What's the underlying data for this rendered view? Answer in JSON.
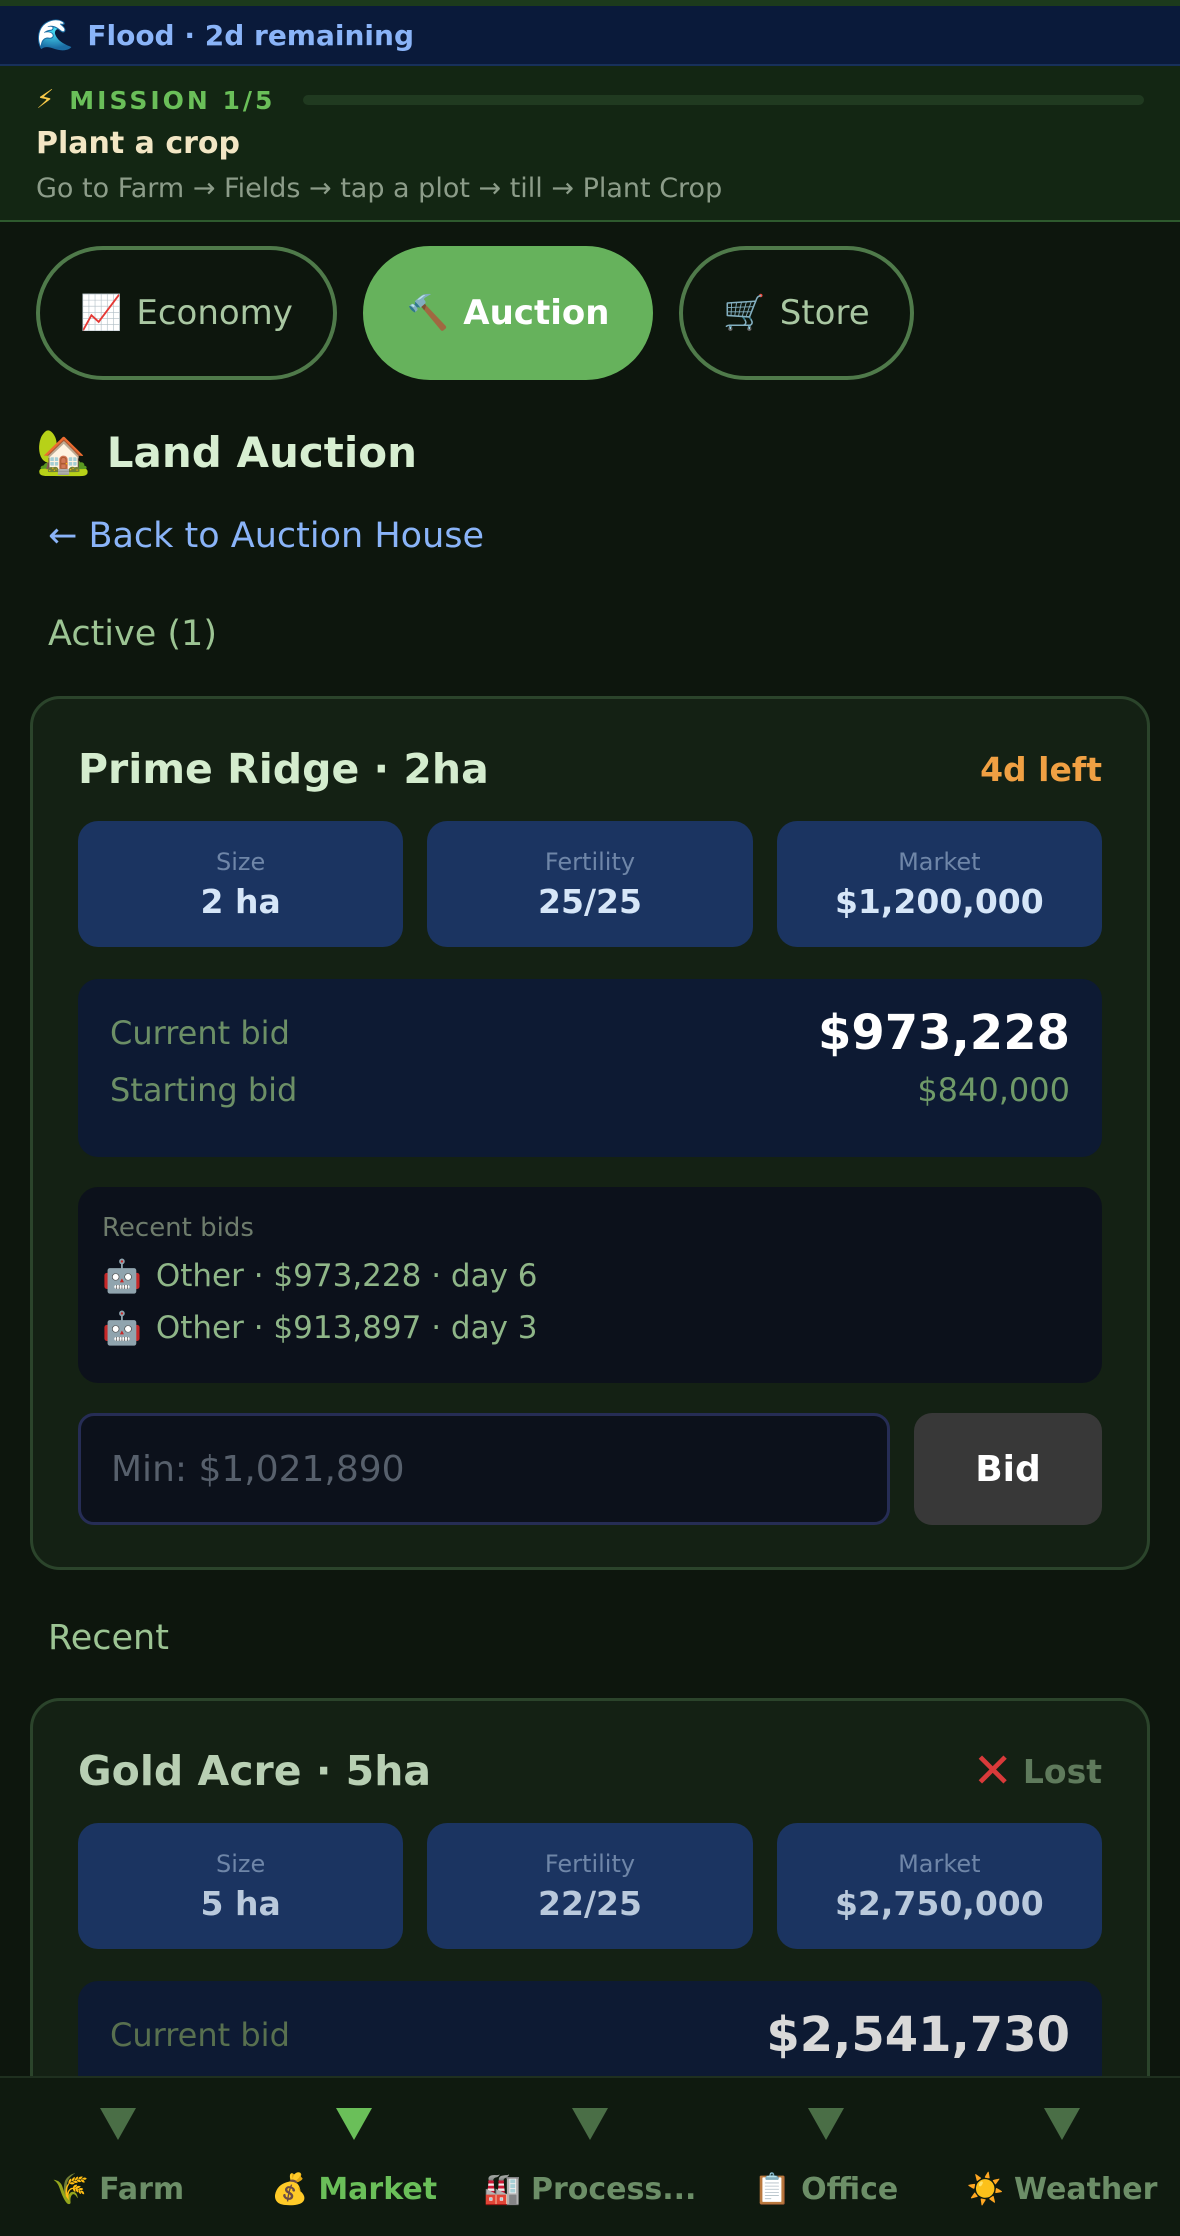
{
  "alert": {
    "icon": "🌊",
    "text": "Flood · 2d remaining"
  },
  "mission": {
    "icon": "⚡",
    "tag": "MISSION 1/5",
    "progress": 0.0,
    "title": "Plant a crop",
    "description": "Go to Farm → Fields → tap a plot → till → Plant Crop"
  },
  "tabs": [
    {
      "icon": "📈",
      "label": "Economy",
      "active": false
    },
    {
      "icon": "🔨",
      "label": "Auction",
      "active": true
    },
    {
      "icon": "🛒",
      "label": "Store",
      "active": false
    }
  ],
  "page": {
    "icon": "🏡",
    "title": "Land Auction",
    "back_link": "← Back to Auction House",
    "active_label": "Active (1)",
    "recent_label": "Recent"
  },
  "active_auction": {
    "title": "Prime Ridge · 2ha",
    "status": "4d left",
    "stats": [
      {
        "label": "Size",
        "value": "2 ha"
      },
      {
        "label": "Fertility",
        "value": "25/25"
      },
      {
        "label": "Market",
        "value": "$1,200,000"
      }
    ],
    "current_bid_label": "Current bid",
    "current_bid": "$973,228",
    "starting_bid_label": "Starting bid",
    "starting_bid": "$840,000",
    "recent_bids_label": "Recent bids",
    "recent_bids": [
      {
        "icon": "🤖",
        "text": "Other · $973,228 · day 6"
      },
      {
        "icon": "🤖",
        "text": "Other · $913,897 · day 3"
      }
    ],
    "bid_placeholder": "Min: $1,021,890",
    "bid_button": "Bid"
  },
  "recent_auction": {
    "title": "Gold Acre · 5ha",
    "status_icon": "✕",
    "status": "Lost",
    "stats": [
      {
        "label": "Size",
        "value": "5 ha"
      },
      {
        "label": "Fertility",
        "value": "22/25"
      },
      {
        "label": "Market",
        "value": "$2,750,000"
      }
    ],
    "current_bid_label": "Current bid",
    "current_bid": "$2,541,730"
  },
  "bottom_nav": [
    {
      "icon": "🌾",
      "label": "Farm",
      "active": false
    },
    {
      "icon": "💰",
      "label": "Market",
      "active": true
    },
    {
      "icon": "🏭",
      "label": "Process...",
      "active": false
    },
    {
      "icon": "📋",
      "label": "Office",
      "active": false
    },
    {
      "icon": "☀️",
      "label": "Weather",
      "active": false
    }
  ]
}
